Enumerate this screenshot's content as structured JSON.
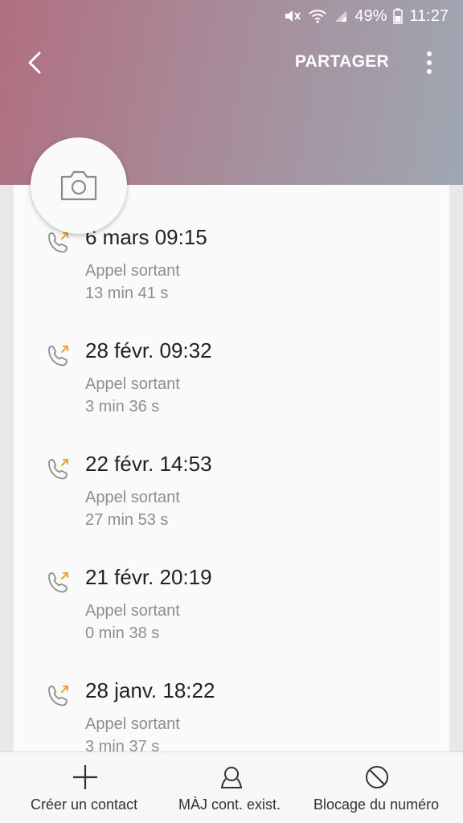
{
  "status_bar": {
    "battery": "49%",
    "time": "11:27"
  },
  "toolbar": {
    "share_label": "PARTAGER",
    "icons": [
      "back-icon",
      "more-icon",
      "camera-icon"
    ]
  },
  "call_log": [
    {
      "date": "6 mars 09:15",
      "type": "Appel sortant",
      "duration": "13 min 41 s"
    },
    {
      "date": "28 févr. 09:32",
      "type": "Appel sortant",
      "duration": "3 min 36 s"
    },
    {
      "date": "22 févr. 14:53",
      "type": "Appel sortant",
      "duration": "27 min 53 s"
    },
    {
      "date": "21 févr. 20:19",
      "type": "Appel sortant",
      "duration": "0 min 38 s"
    },
    {
      "date": "28 janv. 18:22",
      "type": "Appel sortant",
      "duration": "3 min 37 s"
    }
  ],
  "bottom_bar": {
    "create_contact": "Créer un contact",
    "update_contact": "MÀJ cont. exist.",
    "block_number": "Blocage du numéro"
  },
  "colors": {
    "outgoing_arrow": "#f0a030",
    "header_gradient_start": "#b06f80",
    "header_gradient_end": "#9ea7b2"
  }
}
